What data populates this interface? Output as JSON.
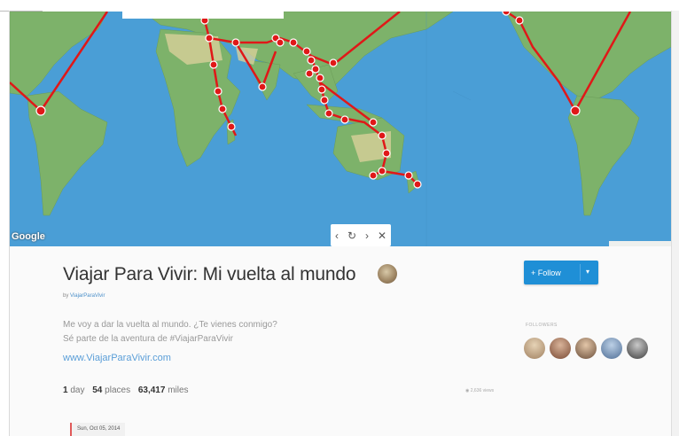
{
  "map": {
    "logo": "Google",
    "controls": {
      "prev": "‹",
      "refresh": "↻",
      "next": "›",
      "close": "✕"
    },
    "colors": {
      "ocean": "#4a9ed6",
      "land": "#7db26a",
      "desert": "#d8cf9a",
      "route": "#e01818"
    }
  },
  "trip": {
    "title": "Viajar Para Vivir: Mi vuelta al mundo",
    "byline_prefix": "by",
    "author": "ViajarParaVivir",
    "description_line1": "Me voy a dar la vuelta al mundo. ¿Te vienes conmigo?",
    "description_line2": "Sé parte de la aventura de #ViajarParaVivir",
    "website": "www.ViajarParaVivir.com",
    "stats": {
      "days_value": "1",
      "days_label": "day",
      "places_value": "54",
      "places_label": "places",
      "miles_value": "63,417",
      "miles_label": "miles"
    },
    "views": "◉ 2,636 views"
  },
  "follow": {
    "label": "+ Follow",
    "caret": "▾"
  },
  "followers": {
    "label": "FOLLOWERS"
  },
  "timeline": {
    "first_date": "Sun, Oct 05, 2014"
  }
}
